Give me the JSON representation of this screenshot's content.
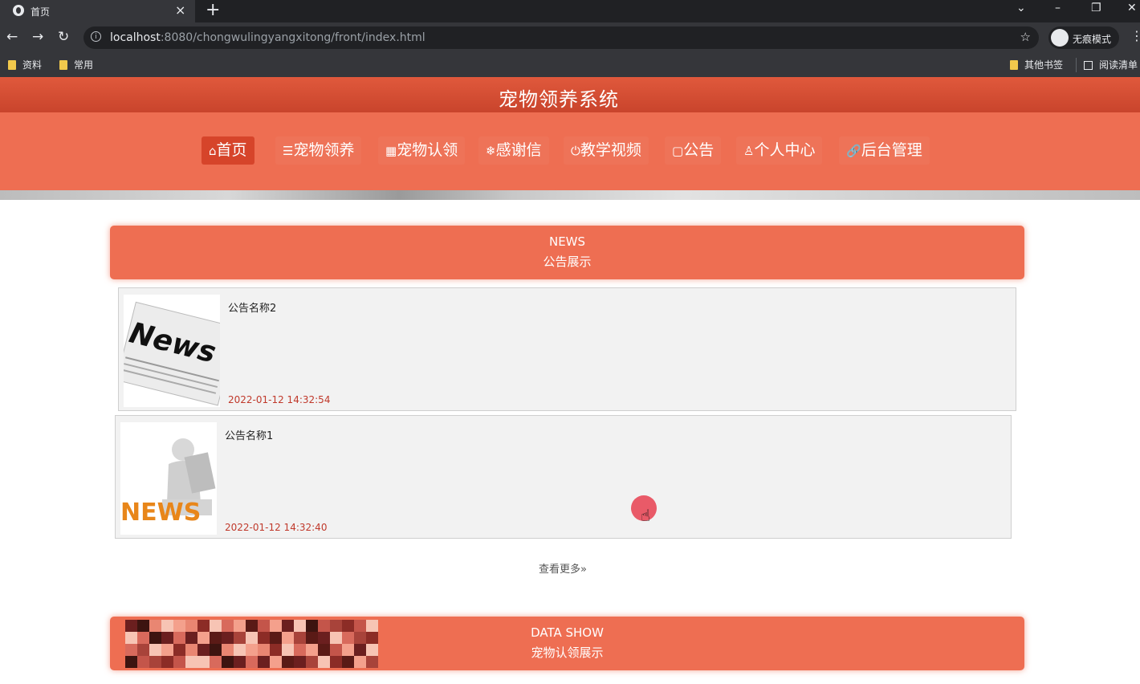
{
  "browser": {
    "tab_title": "首页",
    "tab_close": "×",
    "new_tab": "+",
    "url_host": "localhost",
    "url_rest": ":8080/chongwulingyangxitong/front/index.html",
    "incognito_label": "无痕模式",
    "bookmarks": [
      "资料",
      "常用"
    ],
    "bookmarks_right": [
      "其他书签",
      "阅读清单"
    ]
  },
  "site": {
    "title": "宠物领养系统",
    "nav": [
      {
        "icon": "⌂",
        "label": "首页"
      },
      {
        "icon": "☰",
        "label": "宠物领养"
      },
      {
        "icon": "▦",
        "label": "宠物认领"
      },
      {
        "icon": "❄",
        "label": "感谢信"
      },
      {
        "icon": "⏻",
        "label": "教学视频"
      },
      {
        "icon": "▢",
        "label": "公告"
      },
      {
        "icon": "♙",
        "label": "个人中心"
      },
      {
        "icon": "🔗",
        "label": "后台管理"
      }
    ]
  },
  "news_section": {
    "title_en": "NEWS",
    "title_cn": "公告展示",
    "items": [
      {
        "name": "公告名称2",
        "time": "2022-01-12 14:32:54",
        "image_text": "News"
      },
      {
        "name": "公告名称1",
        "time": "2022-01-12 14:32:40",
        "image_text": "NEWS"
      }
    ],
    "more_label": "查看更多»"
  },
  "data_section": {
    "title_en": "DATA SHOW",
    "title_cn": "宠物认领展示"
  },
  "colors": {
    "header": "#d24e34",
    "nav": "#ee6e52",
    "active_nav": "#d6442a",
    "time_text": "#c0392b"
  }
}
